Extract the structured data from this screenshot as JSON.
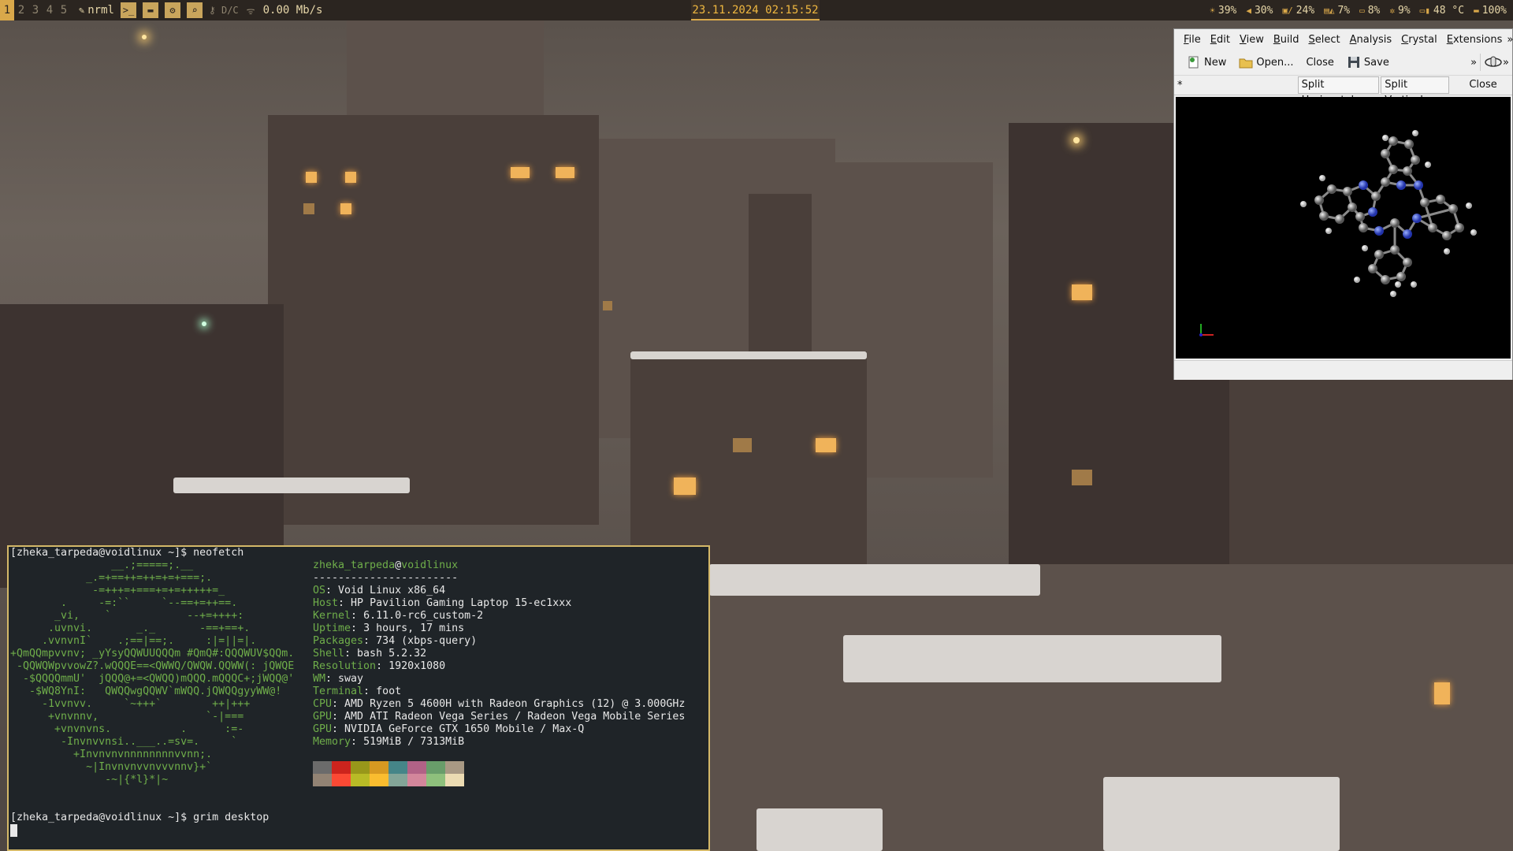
{
  "topbar": {
    "workspaces": [
      "1",
      "2",
      "3",
      "4",
      "5"
    ],
    "active_workspace": "1",
    "mode_label": "nrml",
    "vpn_label": "D/C",
    "net_speed": "0.00 Mb/s",
    "clock": "23.11.2024 02:15:52",
    "status": {
      "brightness": "39%",
      "volume": "30%",
      "disk": "24%",
      "cpu": "7%",
      "memory": "8%",
      "gpu": "9%",
      "temperature": "48 °C",
      "battery": "100%"
    }
  },
  "avogadro": {
    "menus": [
      "File",
      "Edit",
      "View",
      "Build",
      "Select",
      "Analysis",
      "Crystal",
      "Extensions"
    ],
    "menu_more": "»",
    "toolbar": {
      "new_label": "New",
      "open_label": "Open...",
      "close_label": "Close",
      "save_label": "Save",
      "more": "»"
    },
    "tab_title": "*",
    "split_horizontal_label": "Split Horizontal",
    "split_vertical_label": "Split Vertical",
    "close_view_label": "Close"
  },
  "terminal": {
    "prompt1": "[zheka_tarpeda@voidlinux ~]$ neofetch",
    "user_host_user": "zheka_tarpeda",
    "user_host_at": "@",
    "user_host_host": "voidlinux",
    "separator": "-----------------------",
    "info": [
      {
        "key": "OS",
        "value": "Void Linux x86_64"
      },
      {
        "key": "Host",
        "value": "HP Pavilion Gaming Laptop 15-ec1xxx"
      },
      {
        "key": "Kernel",
        "value": "6.11.0-rc6_custom-2"
      },
      {
        "key": "Uptime",
        "value": "3 hours, 17 mins"
      },
      {
        "key": "Packages",
        "value": "734 (xbps-query)"
      },
      {
        "key": "Shell",
        "value": "bash 5.2.32"
      },
      {
        "key": "Resolution",
        "value": "1920x1080"
      },
      {
        "key": "WM",
        "value": "sway"
      },
      {
        "key": "Terminal",
        "value": "foot"
      },
      {
        "key": "CPU",
        "value": "AMD Ryzen 5 4600H with Radeon Graphics (12) @ 3.000GHz"
      },
      {
        "key": "GPU",
        "value": "AMD ATI Radeon Vega Series / Radeon Vega Mobile Series"
      },
      {
        "key": "GPU",
        "value": "NVIDIA GeForce GTX 1650 Mobile / Max-Q"
      },
      {
        "key": "Memory",
        "value": "519MiB / 7313MiB"
      }
    ],
    "logo_lines": [
      "                __.;=====;.__",
      "            _.=+==++=++=+=+===;.",
      "             -=+++=+===+=+=+++++=_",
      "        .     -=:``     `--==+=++==.",
      "       _vi,    `            --+=++++:",
      "      .uvnvi.       _._       -==+==+.",
      "     .vvnvnI`    .;==|==;.     :|=||=|.",
      "+QmQQmpvvnv; _yYsyQQWUUQQQm #QmQ#:QQQWUV$QQm.",
      " -QQWQWpvvowZ?.wQQQE==<QWWQ/QWQW.QQWW(: jQWQE",
      "  -$QQQQmmU'  jQQQ@+=<QWQQ)mQQQ.mQQQC+;jWQQ@'",
      "   -$WQ8YnI:   QWQQwgQQWV`mWQQ.jQWQQgyyWW@!",
      "     -1vvnvv.     `~+++`        ++|+++",
      "      +vnvnnv,                 `-|===",
      "       +vnvnvns.           .      :=-",
      "        -Invnvvnsi..___..=sv=.     `",
      "          +Invnvnvnnnnnnnnvvnn;.",
      "            ~|Invnvnvvnvvvnnv}+`",
      "               -~|{*l}*|~"
    ],
    "palette": [
      "#6b6b6b",
      "#cc241d",
      "#98971a",
      "#d79921",
      "#458588",
      "#b16286",
      "#689d6a",
      "#a89984",
      "#928374",
      "#fb4934",
      "#b8bb26",
      "#fabd2f",
      "#83a598",
      "#d3869b",
      "#8ec07c",
      "#ebdbb2"
    ],
    "prompt2": "[zheka_tarpeda@voidlinux ~]$ grim desktop"
  }
}
